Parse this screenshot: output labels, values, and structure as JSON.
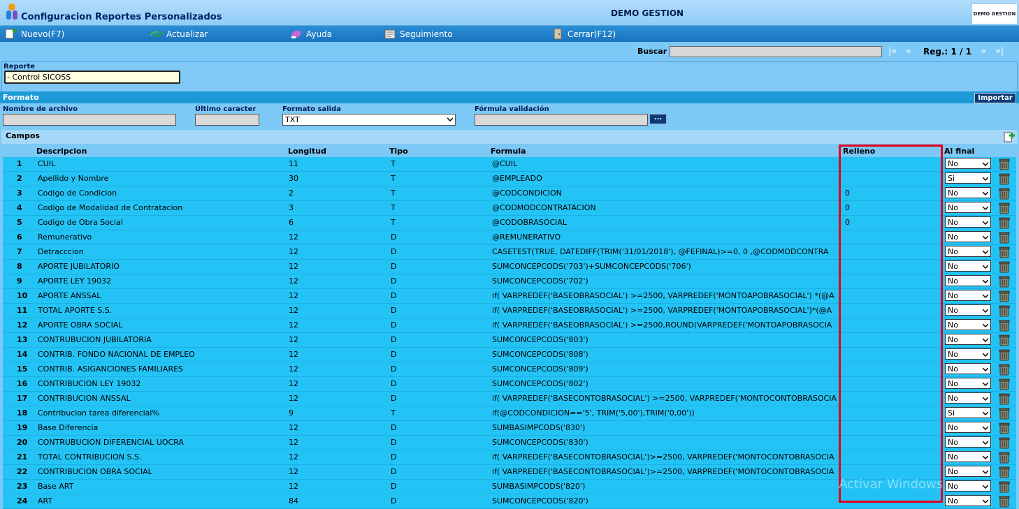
{
  "header": {
    "app_title": "Configuracion Reportes Personalizados",
    "company": "DEMO GESTION",
    "brand": "DEMO GESTION"
  },
  "toolbar": {
    "nuevo": "Nuevo(F7)",
    "actualizar": "Actualizar",
    "ayuda": "Ayuda",
    "seguimiento": "Seguimiento",
    "cerrar": "Cerrar(F12)"
  },
  "search": {
    "label": "Buscar",
    "value": "",
    "first": "|«",
    "prev": "«",
    "reg": "Reg.: 1 / 1",
    "next": "»",
    "last": "»|"
  },
  "reporte": {
    "label": "Reporte",
    "value": "- Control  SICOSS"
  },
  "formato": {
    "title": "Formato",
    "importar": "Importar",
    "nombre_label": "Nombre de archivo",
    "nombre_value": "",
    "ultimo_label": "Último caracter",
    "ultimo_value": "",
    "salida_label": "Formato salida",
    "salida_value": "TXT",
    "formula_label": "Fórmula validación",
    "formula_value": "",
    "dots": "..."
  },
  "campos": {
    "title": "Campos",
    "headers": {
      "descripcion": "Descripcion",
      "longitud": "Longitud",
      "tipo": "Tipo",
      "formula": "Formula",
      "relleno": "Relleno",
      "alfinal": "Al final"
    },
    "rows": [
      {
        "n": "1",
        "desc": "CUIL",
        "len": "11",
        "tipo": "T",
        "formula": "@CUIL",
        "relleno": "",
        "alfinal": "No"
      },
      {
        "n": "2",
        "desc": "Apellido y Nombre",
        "len": "30",
        "tipo": "T",
        "formula": "@EMPLEADO",
        "relleno": "",
        "alfinal": "Si"
      },
      {
        "n": "3",
        "desc": "Codigo de Condicion",
        "len": "2",
        "tipo": "T",
        "formula": "@CODCONDICION",
        "relleno": "0",
        "alfinal": "No"
      },
      {
        "n": "4",
        "desc": "Codigo de Modalidad de Contratacion",
        "len": "3",
        "tipo": "T",
        "formula": "@CODMODCONTRATACION",
        "relleno": "0",
        "alfinal": "No"
      },
      {
        "n": "5",
        "desc": "Codigo de Obra Social",
        "len": "6",
        "tipo": "T",
        "formula": "@CODOBRASOCIAL",
        "relleno": "0",
        "alfinal": "No"
      },
      {
        "n": "6",
        "desc": "Remunerativo",
        "len": "12",
        "tipo": "D",
        "formula": " @REMUNERATIVO",
        "relleno": "",
        "alfinal": "No"
      },
      {
        "n": "7",
        "desc": "Detracccion",
        "len": "12",
        "tipo": "D",
        "formula": " CASETEST(TRUE, DATEDIFF(TRIM('31/01/2018'), @FEFINAL)>=0, 0 ,@CODMODCONTRA",
        "relleno": "",
        "alfinal": "No"
      },
      {
        "n": "8",
        "desc": "APORTE JUBILATORIO",
        "len": "12",
        "tipo": "D",
        "formula": "SUMCONCEPCODS('703')+SUMCONCEPCODS('706')",
        "relleno": "",
        "alfinal": "No"
      },
      {
        "n": "9",
        "desc": "APORTE LEY 19032",
        "len": "12",
        "tipo": "D",
        "formula": "SUMCONCEPCODS('702')",
        "relleno": "",
        "alfinal": "No"
      },
      {
        "n": "10",
        "desc": "APORTE ANSSAL",
        "len": "12",
        "tipo": "D",
        "formula": "if( VARPREDEF('BASEOBRASOCIAL') >=2500, VARPREDEF('MONTOAPOBRASOCIAL') *(@A",
        "relleno": "",
        "alfinal": "No"
      },
      {
        "n": "11",
        "desc": "TOTAL APORTE S.S.",
        "len": "12",
        "tipo": "D",
        "formula": "if( VARPREDEF('BASEOBRASOCIAL')  >=2500, VARPREDEF('MONTOAPOBRASOCIAL')*(@A",
        "relleno": "",
        "alfinal": "No"
      },
      {
        "n": "12",
        "desc": "APORTE OBRA SOCIAL",
        "len": "12",
        "tipo": "D",
        "formula": "if( VARPREDEF('BASEOBRASOCIAL') >=2500,ROUND(VARPREDEF('MONTOAPOBRASOCIA",
        "relleno": "",
        "alfinal": "No"
      },
      {
        "n": "13",
        "desc": "CONTRUBUCION JUBILATORIA",
        "len": "12",
        "tipo": "D",
        "formula": "SUMCONCEPCODS('803')",
        "relleno": "",
        "alfinal": "No"
      },
      {
        "n": "14",
        "desc": " CONTRIB. FONDO NACIONAL DE EMPLEO",
        "len": "12",
        "tipo": "D",
        "formula": "SUMCONCEPCODS('808')",
        "relleno": "",
        "alfinal": "No"
      },
      {
        "n": "15",
        "desc": "CONTRIB. ASIGANCIONES FAMILIARES",
        "len": "12",
        "tipo": "D",
        "formula": "SUMCONCEPCODS('809')",
        "relleno": "",
        "alfinal": "No"
      },
      {
        "n": "16",
        "desc": "CONTRIBUCION LEY 19032",
        "len": "12",
        "tipo": "D",
        "formula": "SUMCONCEPCODS('802')",
        "relleno": "",
        "alfinal": "No"
      },
      {
        "n": "17",
        "desc": "CONTRIBUCION ANSSAL",
        "len": "12",
        "tipo": "D",
        "formula": "if( VARPREDEF('BASECONTOBRASOCIAL') >=2500, VARPREDEF('MONTOCONTOBRASOCIA",
        "relleno": "",
        "alfinal": "No"
      },
      {
        "n": "18",
        "desc": "Contribucion tarea diferencial%",
        "len": "9",
        "tipo": "T",
        "formula": " if(@CODCONDICION=='5', TRIM('5,00'),TRIM('0,00'))",
        "relleno": "",
        "alfinal": "Si"
      },
      {
        "n": "19",
        "desc": "Base Diferencia",
        "len": "12",
        "tipo": "D",
        "formula": " SUMBASIMPCODS('830')",
        "relleno": "",
        "alfinal": "No"
      },
      {
        "n": "20",
        "desc": "CONTRUBUCION DIFERENCIAL UOCRA",
        "len": "12",
        "tipo": "D",
        "formula": "SUMCONCEPCODS('830')",
        "relleno": "",
        "alfinal": "No"
      },
      {
        "n": "21",
        "desc": "TOTAL CONTRIBUCION S.S.",
        "len": "12",
        "tipo": "D",
        "formula": "if( VARPREDEF('BASECONTOBRASOCIAL')>=2500, VARPREDEF('MONTOCONTOBRASOCIA",
        "relleno": "",
        "alfinal": "No"
      },
      {
        "n": "22",
        "desc": "CONTRIBUCION OBRA SOCIAL",
        "len": "12",
        "tipo": "D",
        "formula": "if( VARPREDEF('BASECONTOBRASOCIAL')>=2500, VARPREDEF('MONTOCONTOBRASOCIA",
        "relleno": "",
        "alfinal": "No"
      },
      {
        "n": "23",
        "desc": "Base ART",
        "len": "12",
        "tipo": "D",
        "formula": "SUMBASIMPCODS('820')",
        "relleno": "",
        "alfinal": "No"
      },
      {
        "n": "24",
        "desc": "ART",
        "len": "84",
        "tipo": "D",
        "formula": "SUMCONCEPCODS('820')",
        "relleno": "",
        "alfinal": "No"
      }
    ]
  },
  "watermark": "Activar Windows",
  "colors": {
    "row_bg": "#24c3f5",
    "toolbar_bg": "#1b72bd",
    "highlight": "#e2001a"
  }
}
